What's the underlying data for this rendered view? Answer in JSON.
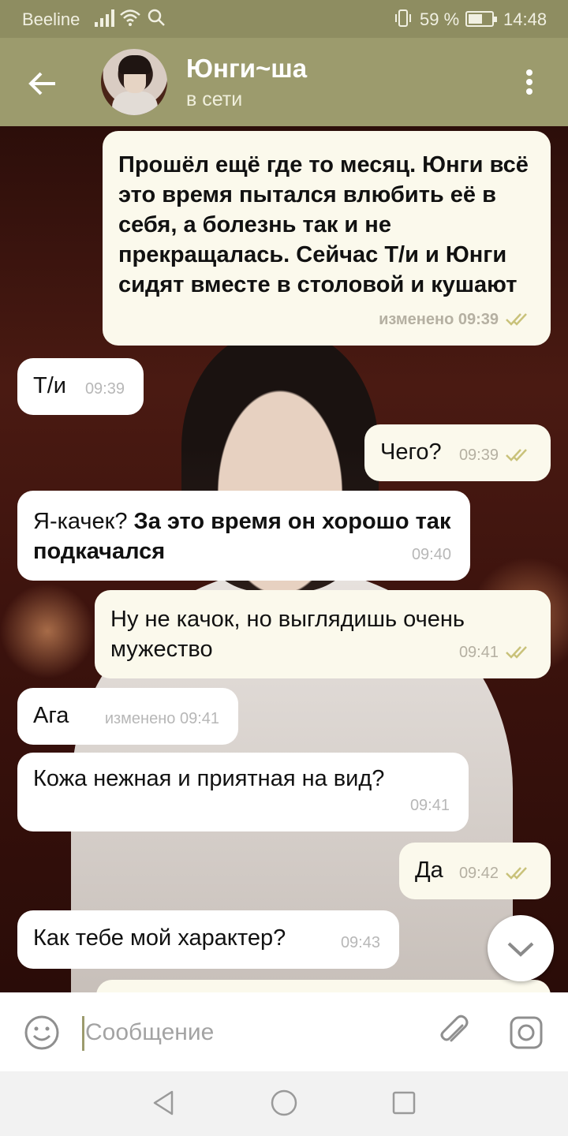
{
  "status_bar": {
    "carrier": "Beeline",
    "battery_percent": "59 %",
    "battery_level": 0.59,
    "time": "14:48",
    "icons": [
      "signal-icon",
      "wifi-icon",
      "search-icon",
      "vibrate-icon",
      "battery-icon"
    ]
  },
  "header": {
    "contact_name": "Юнги~ша",
    "presence": "в сети",
    "icons": [
      "back-arrow-icon",
      "avatar",
      "more-vertical-icon"
    ]
  },
  "messages": [
    {
      "direction": "out",
      "text": "Прошёл ещё где то месяц. Юнги всё это время пытался влюбить её в себя, а болезнь так и не прекращалась. Сейчас Т/и и Юнги сидят вместе в столовой и кушают",
      "meta": "изменено 09:39",
      "read": true
    },
    {
      "direction": "in",
      "text": "Т/и",
      "meta": "09:39"
    },
    {
      "direction": "out",
      "text": "Чего?",
      "meta": "09:39",
      "read": true
    },
    {
      "direction": "in",
      "text_plain": "Я-качек? ",
      "text_bold": "За это время он хорошо так подкачался",
      "meta": "09:40"
    },
    {
      "direction": "out",
      "text": "Ну не качок, но выглядишь очень мужество",
      "meta": "09:41",
      "read": true
    },
    {
      "direction": "in",
      "text": "Ага",
      "meta": "изменено 09:41"
    },
    {
      "direction": "in",
      "text": "Кожа нежная и приятная на вид?",
      "meta": "09:41"
    },
    {
      "direction": "out",
      "text": "Да",
      "meta": "09:42",
      "read": true
    },
    {
      "direction": "in",
      "text": "Как тебе мой характер?",
      "meta": "09:43"
    }
  ],
  "composer": {
    "placeholder": "Сообщение",
    "value": "",
    "icons": [
      "emoji-icon",
      "attach-icon",
      "camera-icon"
    ]
  },
  "nav_bar": {
    "icons": [
      "nav-back-icon",
      "nav-home-icon",
      "nav-recents-icon"
    ]
  },
  "colors": {
    "header": "#9c9b6d",
    "status_bar": "#8e8d61",
    "outgoing_bubble": "#fbf9ec",
    "incoming_bubble": "#ffffff",
    "read_check": "#c9c27a"
  }
}
